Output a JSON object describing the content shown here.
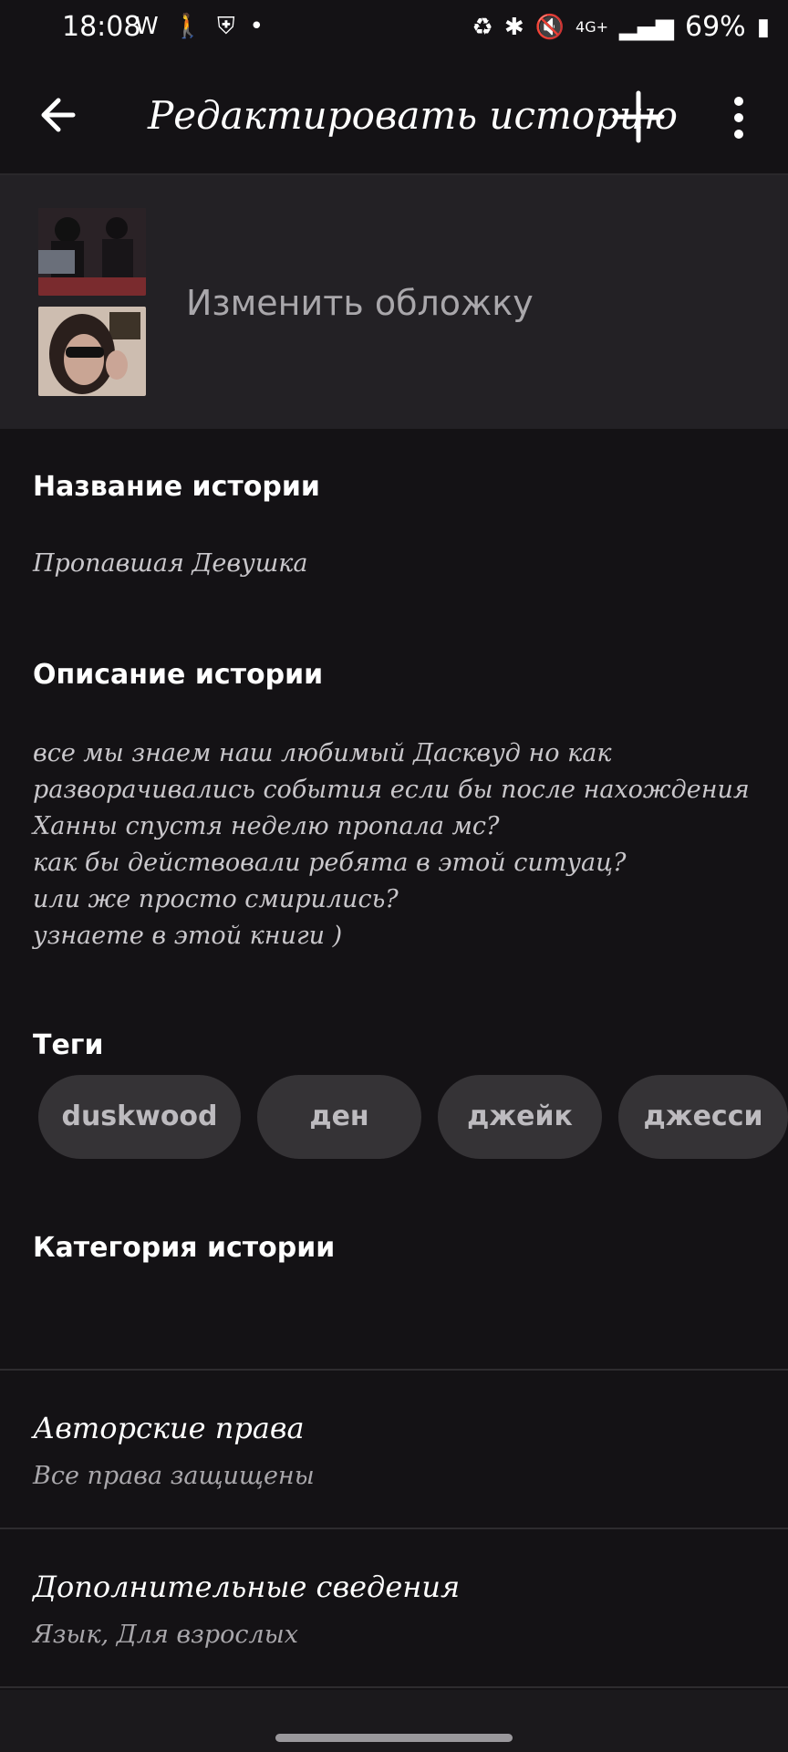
{
  "status_bar": {
    "time": "18:08",
    "battery": "69%",
    "network": "4G+"
  },
  "app_bar": {
    "title": "Редактировать историю",
    "back_icon": "arrow-left-icon",
    "add_icon": "plus-icon",
    "more_icon": "more-vert-icon"
  },
  "cover": {
    "label": "Изменить обложку"
  },
  "story_title": {
    "label": "Название истории",
    "value": "Пропавшая Девушка"
  },
  "story_description": {
    "label": "Описание истории",
    "lines": [
      "все мы знаем наш любимый Дасквуд но как",
      "разворачивались события если бы после нахождения",
      "Ханны спустя неделю пропала мс?",
      "как бы действовали ребята в этой ситуац?",
      "или же просто смирились?",
      "узнаете в этой книги )"
    ]
  },
  "tags": {
    "label": "Теги",
    "items": [
      "duskwood",
      "ден",
      "джейк",
      "джесси"
    ]
  },
  "category": {
    "label": "Категория истории"
  },
  "copyright": {
    "title": "Авторские права",
    "value": "Все права защищены"
  },
  "additional": {
    "title": "Дополнительные сведения",
    "value": "Язык, Для взрослых"
  },
  "colors": {
    "background": "#141215",
    "cover_section": "#232125",
    "tag_bg": "#353336"
  }
}
